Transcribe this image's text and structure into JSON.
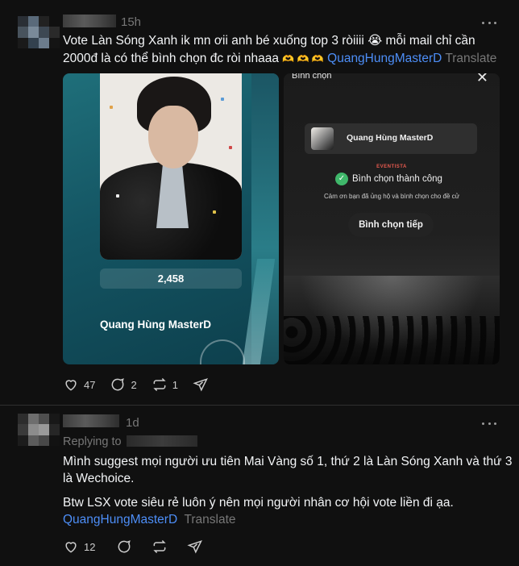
{
  "post1": {
    "time": "15h",
    "text_line1_a": "Vote Làn Sóng Xanh ik mn ơii anh bé xuống top 3 ròiiii ",
    "emoji1": "😭",
    "text_line1_b": " mỗi mail chỉ cần",
    "text_line2_a": "2000đ là có thể bình chọn đc ròi nhaaa ",
    "emoji2": "🫶 🫶 🫶",
    "mention": "QuangHungMasterD",
    "translate": "Translate",
    "media_left": {
      "vote_count": "2,458",
      "artist_name": "Quang Hùng MasterD"
    },
    "media_right": {
      "title": "Bình chọn",
      "close": "✕",
      "artist_name": "Quang Hùng MasterD",
      "brand": "EVENTISTA",
      "success": "Bình chọn thành công",
      "thanks": "Cảm ơn bạn đã ủng hộ và bình chọn cho đề cử",
      "again_button": "Bình chọn tiếp"
    },
    "likes": "47",
    "replies": "2",
    "reposts": "1"
  },
  "post2": {
    "time": "1d",
    "replying_to": "Replying to",
    "line1": "Mình suggest mọi người ưu tiên Mai Vàng số 1, thứ 2 là Làn Sóng Xanh và thứ 3",
    "line2": "là Wechoice.",
    "line3": "Btw LSX vote siêu rẻ luôn ý nên mọi người nhân cơ hội vote liền đi ạa.",
    "mention": "QuangHungMasterD",
    "translate": "Translate",
    "likes": "12"
  },
  "icons": {
    "like": "heart-icon",
    "reply": "comment-icon",
    "repost": "repost-icon",
    "share": "send-icon",
    "more": "more-icon"
  }
}
